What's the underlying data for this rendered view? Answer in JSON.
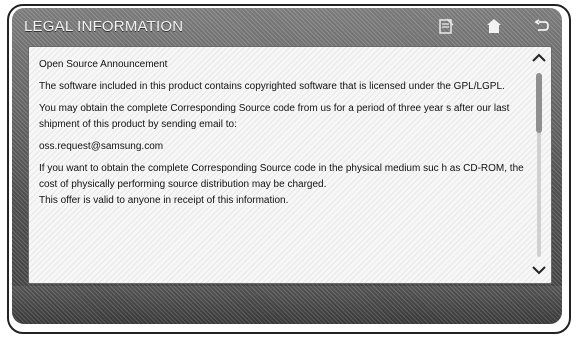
{
  "header": {
    "title": "LEGAL INFORMATION",
    "icons": {
      "edit": "note-edit-icon",
      "home": "home-icon",
      "back": "back-arrow-icon"
    }
  },
  "content": {
    "heading": "Open Source Announcement",
    "para1": "The software included in this product contains copyrighted software that is licensed under the GPL/LGPL.",
    "para2": "You may obtain the complete Corresponding Source code from us for a period of three year s after our last shipment of this product by sending email to:",
    "email": "oss.request@samsung.com",
    "para3": "If you want to obtain the complete Corresponding Source code in the physical medium suc h as CD-ROM, the cost of physically performing source distribution may be charged.",
    "para4": "This offer is valid to anyone in receipt of this information."
  },
  "scroll": {
    "up_icon": "chevron-up-icon",
    "down_icon": "chevron-down-icon"
  }
}
